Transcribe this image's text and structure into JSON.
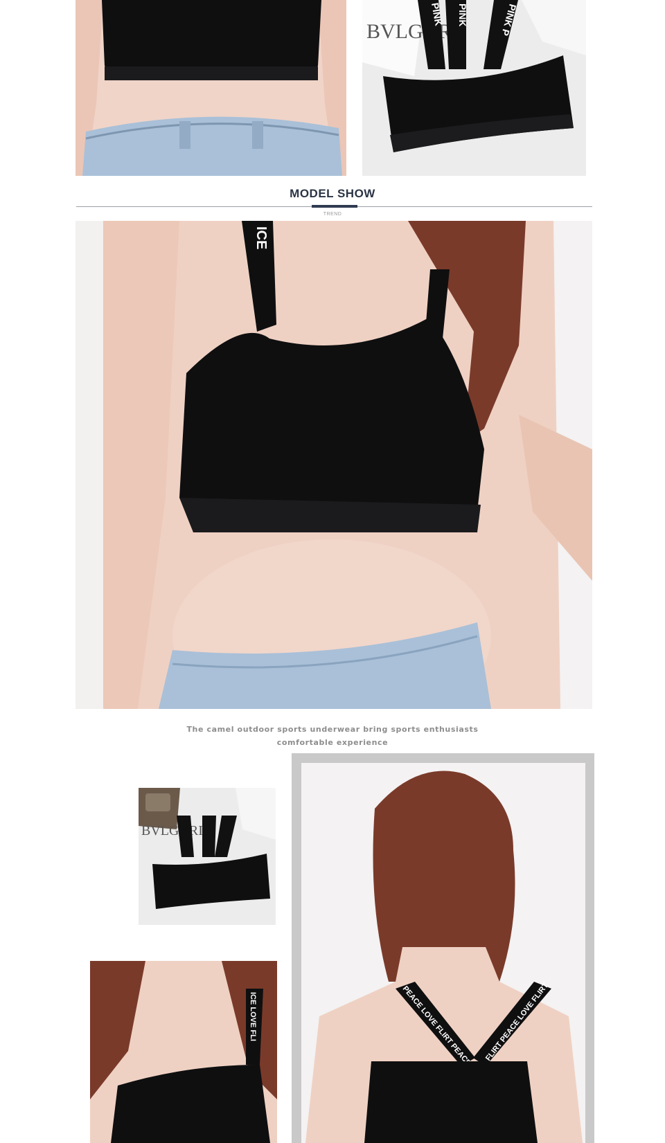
{
  "section": {
    "title": "MODEL SHOW",
    "subtitle": "TREND"
  },
  "caption": {
    "line1": "The camel outdoor sports underwear bring sports enthusiasts",
    "line2": "comfortable experience"
  },
  "photos": {
    "top_left_back": "Model back view in black crop bra with denim jeans",
    "top_right_flatlay": "Black sports bra flat lay with PINK straps",
    "main_front": "Model front view wearing black sports bra with ICE strap",
    "small_flatlay": "Black sports bra flat lay with PINK straps on desk",
    "small_front": "Model front view with ICE LOVE strap",
    "large_back": "Model back view with PEACE LOVE FLIRT cross straps"
  },
  "strap_text": {
    "pink_a": "PINK",
    "pink_b": "PINK",
    "pink_c": "PINK P",
    "bvlgari": "BVLGARI",
    "ice": "ICE",
    "ice_love": "ICE LOVE FLI",
    "peace_left": "PEACE LOVE FLIRT PEACE",
    "peace_right": "FLIRT PEACE LOVE FLIRT"
  },
  "colors": {
    "bra": "#0f0f10",
    "skin": "#efd1c3",
    "denim": "#a9c0d8",
    "hair": "#7a3a2a",
    "title": "#2b3445"
  }
}
